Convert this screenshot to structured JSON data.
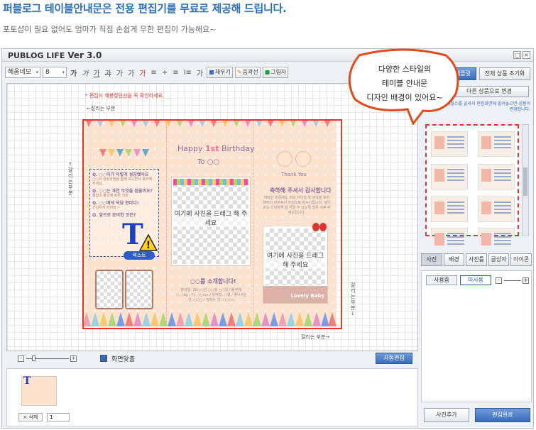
{
  "headline": "퍼블로그 테이블안내문은 전용 편집기를 무료로 제공해 드립니다.",
  "subline": "포토샵이 필요 없어도 엄마가 직접 손쉽게 무한 편집이 가능해요~",
  "window": {
    "app_name": "PUBLOG LIFE",
    "version_label": "Ver 3.0",
    "min_glyph": "□",
    "close_glyph": "×"
  },
  "toolbar": {
    "font_family": "헤움네모",
    "font_size": "8",
    "select_arrow": "▾",
    "style_glyphs": [
      "가",
      "가",
      "가",
      "가",
      "가",
      "가",
      "가"
    ],
    "align_glyphs": [
      "≡",
      "+",
      "≡",
      "I≡",
      "가"
    ],
    "fill_label": "채우기",
    "line_label": "음곽선",
    "shadow_label": "그림자"
  },
  "canvas": {
    "warning_note": "* 편집시 재봉절단선을 꼭 확인하세요.",
    "cut_label_top": "←잘리는 부분",
    "cut_label_left": "↑잘리는 부분",
    "cut_label_right": "잘리는 부분↓",
    "cut_label_bottom": "잘리는 부분→",
    "happy": "Happy",
    "first": "1st",
    "birthday": "Birthday",
    "to_line": "To ○○",
    "photo_caption": "여기에 사진을 드래그 해 주세요",
    "introduce_title": "○○를 소개합니다!",
    "introduce_text": "출생일: 20○○년 ○○월 ○○일 / 몸무게: ○.○kg / 키: ○○cm / 혈액형: ○형 / 좋아하는 것: ○○○ / 잘하는 것: ○○○○",
    "thank_you": "Thank You",
    "thanks_title": "축하해 주셔서 감사합니다",
    "thanks_text": "바쁘신 와중에도 저희 아이의 첫 생일을 축하해주러 와주셔서 진심으로 감사드립니다. 앞으로도 건강하게 잘 자랄 수 있도록 많은 사랑 부탁드립니다.",
    "photo2_caption": "여기에 사진을 드래그 해 주세요",
    "lovely_baby": "Lovely Baby",
    "text_tag": "텍스트",
    "text_big_icon": "T",
    "warn_glyph": "!",
    "quiz_q1": "Q. ○○이가 이렇게 성장했어요",
    "quiz_q2": "Q. ○○는 과연 무엇을 잡을까요?",
    "quiz_q3": "Q. ○○에게 덕담 한마디!",
    "quiz_q4": "Q. 앞으로 준비한 것은?",
    "quiz_line": "○○의 성장과정을 함께 보시면서 축하해 주세요.",
    "quiz_line2": "돌잡이 물건에 따른 의미",
    "quiz_line3": "건강하게 자라라 ~"
  },
  "bottom_bar": {
    "zoom_minus": "-",
    "zoom_plus": "+",
    "fit_label": "화면맞춤",
    "auto_edit": "자동편집"
  },
  "page_strip": {
    "delete_label": "× 삭제",
    "page_number": "1"
  },
  "right_panel": {
    "tab_template": "템플릿",
    "tab_reset": "전체 상품 초기화",
    "change_product": "다른 상품으로 변경",
    "hint": "템플스를 골라서 편집화면에 올려놓으면 상품이 변경됩니다.",
    "sub_tabs": [
      "사진",
      "배경",
      "사진틀",
      "글상자",
      "아이콘"
    ],
    "use_tabs": [
      "사용중",
      "미사용"
    ],
    "add_photo": "사진추가",
    "done": "편집완료"
  },
  "bubble": {
    "line1": "다양한 스타일의",
    "line2": "테이블 안내문",
    "line3": "디자인 배경이 있어요~"
  },
  "colors": {
    "headline": "#2a6fb5",
    "cut_line": "#ee3322",
    "card_bg": "#fbe3cf",
    "accent_blue": "#3b6cbd",
    "bubble_border": "#e14a1c"
  }
}
